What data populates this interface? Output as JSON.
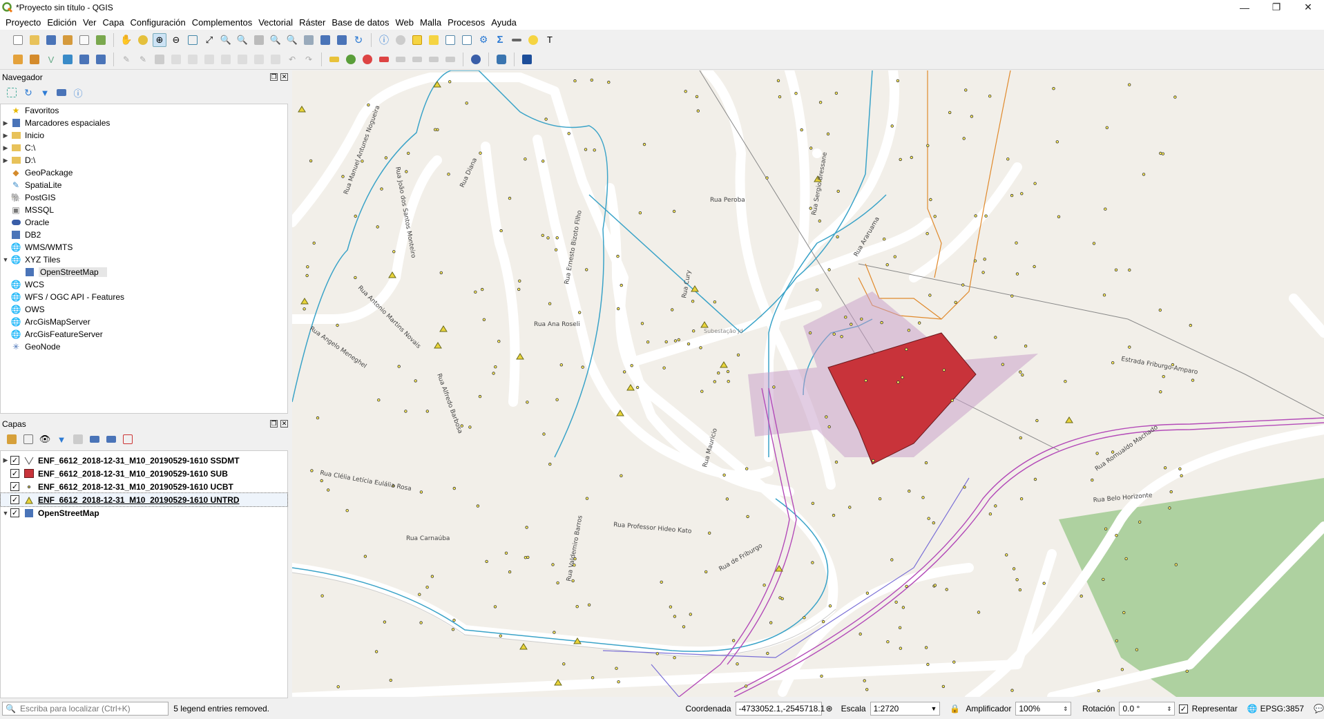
{
  "window": {
    "title": "*Proyecto sin título - QGIS",
    "minimize": "—",
    "restore": "❐",
    "close": "✕"
  },
  "menu": [
    "Proyecto",
    "Edición",
    "Ver",
    "Capa",
    "Configuración",
    "Complementos",
    "Vectorial",
    "Ráster",
    "Base de datos",
    "Web",
    "Malla",
    "Procesos",
    "Ayuda"
  ],
  "browser_panel": {
    "title": "Navegador",
    "items": [
      {
        "label": "Favoritos",
        "icon": "star-icon",
        "arrow": ""
      },
      {
        "label": "Marcadores espaciales",
        "icon": "bookmark-icon",
        "arrow": "▶"
      },
      {
        "label": "Inicio",
        "icon": "folder-icon",
        "arrow": "▶"
      },
      {
        "label": "C:\\",
        "icon": "drive-icon",
        "arrow": "▶"
      },
      {
        "label": "D:\\",
        "icon": "drive-icon",
        "arrow": "▶"
      },
      {
        "label": "GeoPackage",
        "icon": "geopackage-icon",
        "arrow": ""
      },
      {
        "label": "SpatiaLite",
        "icon": "spatialite-icon",
        "arrow": ""
      },
      {
        "label": "PostGIS",
        "icon": "postgis-icon",
        "arrow": ""
      },
      {
        "label": "MSSQL",
        "icon": "mssql-icon",
        "arrow": ""
      },
      {
        "label": "Oracle",
        "icon": "oracle-icon",
        "arrow": ""
      },
      {
        "label": "DB2",
        "icon": "db2-icon",
        "arrow": ""
      },
      {
        "label": "WMS/WMTS",
        "icon": "globe-icon",
        "arrow": ""
      },
      {
        "label": "XYZ Tiles",
        "icon": "globe-icon",
        "arrow": "▼"
      },
      {
        "label": "OpenStreetMap",
        "icon": "xyz-tile-icon",
        "arrow": "",
        "child": true
      },
      {
        "label": "WCS",
        "icon": "globe-icon",
        "arrow": ""
      },
      {
        "label": "WFS / OGC API - Features",
        "icon": "globe-icon",
        "arrow": ""
      },
      {
        "label": "OWS",
        "icon": "globe-icon",
        "arrow": ""
      },
      {
        "label": "ArcGisMapServer",
        "icon": "globe-icon",
        "arrow": ""
      },
      {
        "label": "ArcGisFeatureServer",
        "icon": "globe-icon",
        "arrow": ""
      },
      {
        "label": "GeoNode",
        "icon": "geonode-icon",
        "arrow": ""
      }
    ]
  },
  "layers_panel": {
    "title": "Capas",
    "layers": [
      {
        "label": "ENF_6612_2018-12-31_M10_20190529-1610 SSDMT",
        "symbol": "line",
        "checked": "✓",
        "arrow": "▶"
      },
      {
        "label": "ENF_6612_2018-12-31_M10_20190529-1610 SUB",
        "symbol": "polygon-red",
        "checked": "✓",
        "arrow": ""
      },
      {
        "label": "ENF_6612_2018-12-31_M10_20190529-1610 UCBT",
        "symbol": "point",
        "checked": "✓",
        "arrow": ""
      },
      {
        "label": "ENF_6612_2018-12-31_M10_20190529-1610 UNTRD",
        "symbol": "triangle",
        "checked": "✓",
        "arrow": ""
      },
      {
        "label": "OpenStreetMap",
        "symbol": "xyz",
        "checked": "✓",
        "arrow": "▼"
      }
    ]
  },
  "map": {
    "street_labels": [
      "Rua Manuel Antunes Nogueira",
      "Rua João dos Santos Monteiro",
      "Rua Diana",
      "Rua Ana Roseli",
      "Rua Ernesto Bizoto Filho",
      "Rua Peroba",
      "Rua Cury",
      "Rua Sergio Bressane",
      "Rua Araruama",
      "Estrada Friburgo-Amparo",
      "Rua Romualdo Machado",
      "Rua Belo Horizonte",
      "Rua Professor Hideo Kato",
      "Rua Carnaúba",
      "Rua Clélia Letícia Eulália Rosa",
      "Rua Angelo Meneghel",
      "Rua Antonio Martins Novais",
      "Rua Alfredo Barbosa",
      "Rua Valdemiro Barros",
      "Rua Mauricio",
      "Rua de Friburgo",
      "Subestação Jd"
    ],
    "colors": {
      "background": "#f2efe9",
      "road": "#ffffff",
      "network": "#3aa3c8",
      "substation": "#c8333a",
      "park": "#a8cf91",
      "purple_line": "#b34ab8"
    }
  },
  "status": {
    "locator_placeholder": "Escriba para localizar (Ctrl+K)",
    "message": "5 legend entries removed.",
    "coordinate_label": "Coordenada",
    "coordinate_value": "-4733052.1,-2545718.1",
    "scale_label": "Escala",
    "scale_value": "1:2720",
    "magnifier_label": "Amplificador",
    "magnifier_value": "100%",
    "rotation_label": "Rotación",
    "rotation_value": "0.0 °",
    "render_label": "Representar",
    "render_checked": "✓",
    "crs": "EPSG:3857"
  }
}
